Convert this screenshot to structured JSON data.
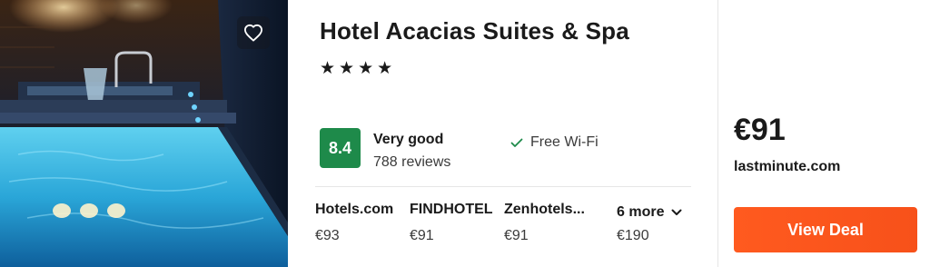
{
  "hotel": {
    "name": "Hotel Acacias Suites & Spa",
    "stars": "★★★★",
    "star_count": 4,
    "rating_score": "8.4",
    "rating_word": "Very good",
    "review_count": "788 reviews",
    "amenity": "Free Wi-Fi"
  },
  "providers": [
    {
      "name": "Hotels.com",
      "price": "€93"
    },
    {
      "name": "FINDHOTEL",
      "price": "€91"
    },
    {
      "name": "Zenhotels...",
      "price": "€91"
    }
  ],
  "more": {
    "label": "6 more",
    "price": "€190"
  },
  "best_deal": {
    "price": "€91",
    "provider": "lastminute.com",
    "button_label": "View Deal"
  },
  "colors": {
    "rating_badge": "#1e8a4a",
    "deal_button": "#ff5a1f",
    "check_icon": "#1e8a4a"
  },
  "icons": {
    "favorite": "heart-icon",
    "amenity": "check-icon",
    "more": "chevron-down-icon"
  }
}
